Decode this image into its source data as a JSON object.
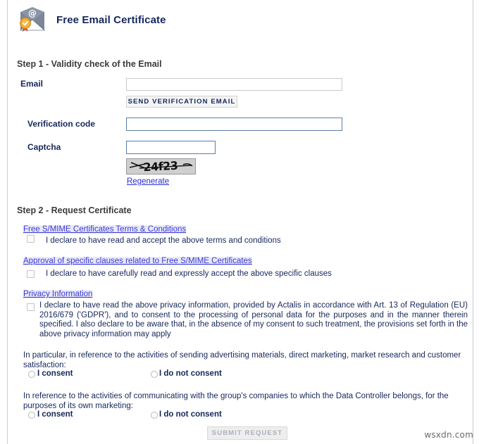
{
  "header": {
    "title": "Free Email Certificate",
    "icon": "email-certificate-icon"
  },
  "step1": {
    "heading": "Step 1 - Validity check of the Email",
    "email": {
      "label": "Email",
      "value": "",
      "placeholder": ""
    },
    "send_verification_button": "SEND VERIFICATION EMAIL",
    "verification_code": {
      "label": "Verification code",
      "value": "",
      "placeholder": ""
    },
    "captcha": {
      "label": "Captcha",
      "value": "",
      "placeholder": "",
      "image_text": "24f23",
      "regenerate_link": "Regenerate"
    }
  },
  "step2": {
    "heading": "Step 2 - Request Certificate",
    "terms": {
      "link": "Free S/MIME Certificates Terms & Conditions",
      "consent_text": "I declare to have read and accept the above terms and conditions",
      "checked": false
    },
    "clauses": {
      "link": "Approval of specific clauses related to Free S/MIME Certificates",
      "consent_text": "I declare to have carefully read and expressly accept the above specific clauses",
      "checked": false
    },
    "privacy": {
      "link": "Privacy Information",
      "consent_text": "I declare to have read the above privacy information, provided by Actalis in accordance with Art. 13 of Regulation (EU) 2016/679 ('GDPR'), and to consent to the processing of personal data for the purposes and in the manner therein specified. I also declare to be aware that, in the absence of my consent to such treatment, the provisions set forth in the above privacy information may apply",
      "checked": false
    },
    "marketing_consent": {
      "question": "In particular, in reference to the activities of sending advertising materials, direct marketing, market research and customer satisfaction:",
      "option_yes": "I consent",
      "option_no": "I do not consent",
      "selected": ""
    },
    "group_consent": {
      "question": "In reference to the activities of communicating with the group's companies to which the Data Controller belongs, for the purposes of its own marketing:",
      "option_yes": "I consent",
      "option_no": "I do not consent",
      "selected": ""
    },
    "submit_button": "SUBMIT REQUEST"
  },
  "watermark": "wsxdn.com",
  "colors": {
    "title": "#16275c",
    "link": "#2b2bd4",
    "heading": "#3b3b3b",
    "input_border_active": "#5b7fa6",
    "input_border_inactive": "#c9c9c9"
  }
}
